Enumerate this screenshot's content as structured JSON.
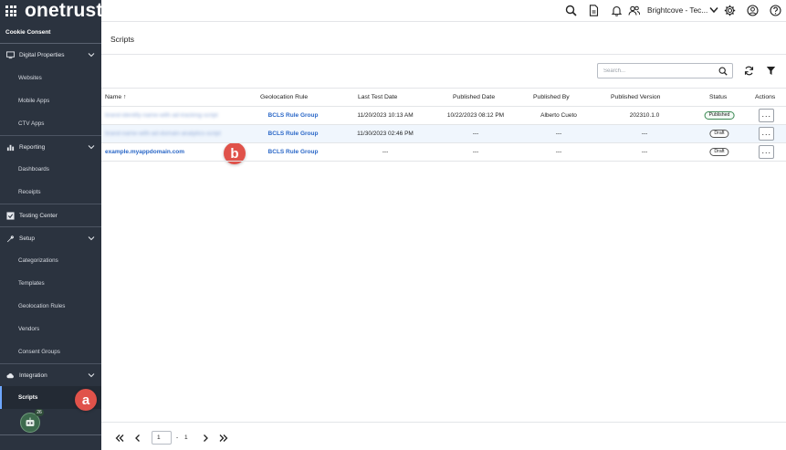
{
  "app": {
    "logo": "onetrust",
    "product": "Cookie Consent"
  },
  "sidebar": {
    "groups": [
      {
        "label": "Digital Properties",
        "icon": "monitor-icon",
        "items": [
          "Websites",
          "Mobile Apps",
          "CTV Apps"
        ]
      },
      {
        "label": "Reporting",
        "icon": "bar-chart-icon",
        "items": [
          "Dashboards",
          "Receipts"
        ]
      },
      {
        "label": "Testing Center",
        "icon": "testing-center-icon",
        "items": []
      },
      {
        "label": "Setup",
        "icon": "wrench-icon",
        "items": [
          "Categorizations",
          "Templates",
          "Geolocation Rules",
          "Vendors",
          "Consent Groups"
        ]
      },
      {
        "label": "Integration",
        "icon": "cloud-icon",
        "items": [
          "Scripts"
        ]
      }
    ],
    "active_item": "Scripts",
    "bot_badge": "26"
  },
  "topbar": {
    "tenant": "Brightcove - Tec..."
  },
  "page": {
    "title": "Scripts"
  },
  "toolbar": {
    "search_placeholder": "Search..."
  },
  "table": {
    "columns": [
      "Name",
      "Geolocation Rule",
      "Last Test Date",
      "Published Date",
      "Published By",
      "Published Version",
      "Status",
      "Actions"
    ],
    "sort_indicator": "↑",
    "rows": [
      {
        "name": "brand-identify-name-with-ad-tracking-script",
        "name_blurred": true,
        "geo": "BCLS Rule Group",
        "last_test": "11/20/2023 10:13 AM",
        "published_date": "10/22/2023 08:12 PM",
        "published_by": "Alberto Cueto",
        "version": "202310.1.0",
        "status": "Published",
        "actions": "···"
      },
      {
        "name": "brand-name-with-ad-domain-analytics-script",
        "name_blurred": true,
        "geo": "BCLS Rule Group",
        "last_test": "11/30/2023 02:46 PM",
        "published_date": "---",
        "published_by": "---",
        "version": "---",
        "status": "Draft",
        "actions": "···"
      },
      {
        "name": "example.myappdomain.com",
        "name_blurred": false,
        "geo": "BCLS Rule Group",
        "last_test": "---",
        "published_date": "---",
        "published_by": "---",
        "version": "---",
        "status": "Draft",
        "actions": "···"
      }
    ]
  },
  "pagination": {
    "current": "1",
    "separator": "-",
    "total": "1"
  },
  "annotations": {
    "a": "a",
    "b": "b"
  },
  "colors": {
    "sidebar_bg": "#2b333f",
    "link": "#2a67c7",
    "marker": "#e0524a",
    "published_border": "#3d8a55"
  }
}
